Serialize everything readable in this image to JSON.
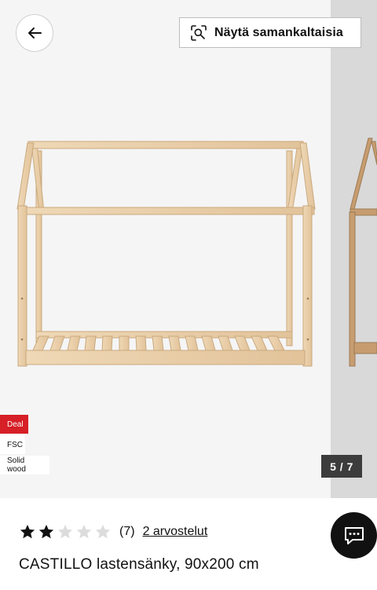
{
  "header": {
    "back_icon": "arrow-left-icon",
    "similar_icon": "visual-search-icon",
    "similar_label": "Näytä samankaltaisia"
  },
  "gallery": {
    "badges": [
      {
        "label": "Deal",
        "color": "#d61f26"
      },
      {
        "label": "FSC"
      },
      {
        "label": "Solid wood"
      }
    ],
    "counter": "5 / 7"
  },
  "product": {
    "rating": 2,
    "rating_max": 5,
    "rating_count": "(7)",
    "reviews_link": "2 arvostelut",
    "title": "CASTILLO lastensänky, 90x200 cm"
  },
  "chat": {
    "icon": "chat-icon"
  },
  "colors": {
    "accent": "#111111",
    "deal": "#d61f26",
    "wood": "#ecd3ad",
    "wood_edge": "#c9a97e"
  }
}
